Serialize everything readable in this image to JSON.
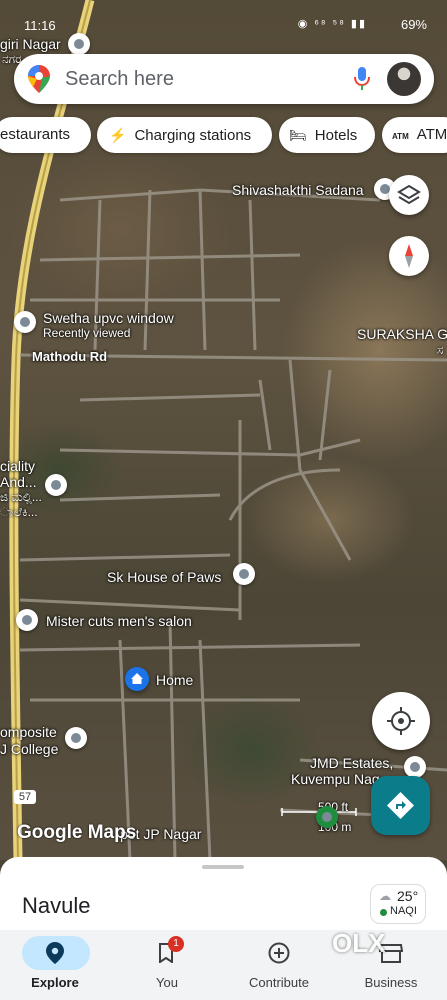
{
  "status": {
    "time": "11:16",
    "battery": "69%",
    "icons": "◉ ⁶⁸ ⁵⁸ ▮▮"
  },
  "search": {
    "placeholder": "Search here"
  },
  "chips": [
    {
      "icon": "restaurant-icon",
      "label": "estaurants"
    },
    {
      "icon": "charging-icon",
      "label": "Charging stations"
    },
    {
      "icon": "hotel-icon",
      "label": "Hotels"
    },
    {
      "icon": "atm-icon",
      "label": "ATM"
    }
  ],
  "map_labels": {
    "giri_nagar": "giri Nagar",
    "kannada_top": "ನಗರ",
    "shivashakthi": "Shivashakthi Sadana",
    "swetha": "Swetha upvc window",
    "recently_viewed": "Recently viewed",
    "mathodu": "Mathodu Rd",
    "suraksha": "SURAKSHA G",
    "suraksha_k": "ಸ",
    "ciality": "ciality",
    "and": "And...",
    "kannada_mid1": "ಜಿ ಮಲ್ಲಿ...",
    "kannada_mid2": "ಾಲೆಕಿ...",
    "sk_house": "Sk House of Paws",
    "mister_cuts": "Mister cuts men's salon",
    "home": "Home",
    "composite": "omposite",
    "college": "J College",
    "jmd": "JMD Estates,",
    "kuvempu": "Kuvempu Nag",
    "jp_nagar": "pot JP Nagar",
    "road_57": "57",
    "scale_m": "500 ft",
    "scale_ft": "100 m"
  },
  "google_logo": "Google Maps",
  "sheet": {
    "place": "Navule",
    "temp": "25°",
    "aqi": "NAQI"
  },
  "nav": {
    "explore": "Explore",
    "you": "You",
    "you_badge": "1",
    "contribute": "Contribute",
    "business": "Business"
  },
  "watermark": "OLX"
}
